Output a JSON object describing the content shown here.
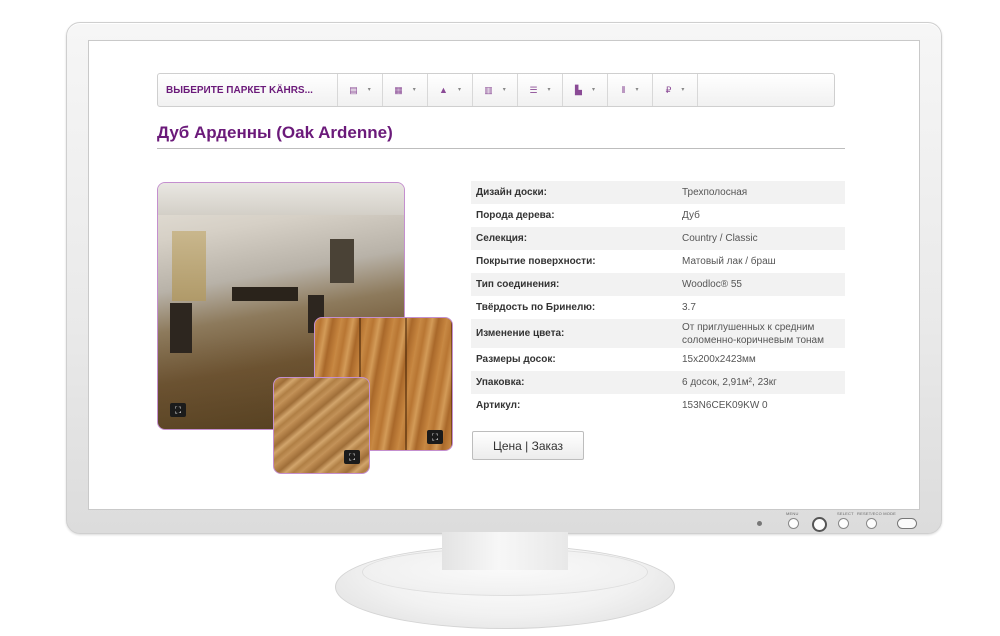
{
  "toolbar": {
    "select_label": "ВЫБЕРИТЕ ПАРКЕТ KÄHRS...",
    "items": [
      {
        "icon": "list-icon",
        "glyph": "▤",
        "caret": "▾"
      },
      {
        "icon": "grid-icon",
        "glyph": "▦",
        "caret": "▾"
      },
      {
        "icon": "tree-icon",
        "glyph": "▲",
        "caret": "▾"
      },
      {
        "icon": "plank-icon",
        "glyph": "▥",
        "caret": "▾"
      },
      {
        "icon": "lines-icon",
        "glyph": "☰",
        "caret": "▾"
      },
      {
        "icon": "layers-icon",
        "glyph": "▙",
        "caret": "▾"
      },
      {
        "icon": "columns-icon",
        "glyph": "⦀",
        "caret": "▾"
      },
      {
        "icon": "ruble-icon",
        "glyph": "₽",
        "caret": "▾"
      }
    ]
  },
  "product": {
    "title": "Дуб Арденны (Oak Ardenne)"
  },
  "specs": [
    {
      "key": "Дизайн доски:",
      "value": "Трехполосная"
    },
    {
      "key": "Порода дерева:",
      "value": "Дуб"
    },
    {
      "key": "Селекция:",
      "value": "Country / Classic"
    },
    {
      "key": "Покрытие поверхности:",
      "value": "Матовый лак / браш"
    },
    {
      "key": "Тип соединения:",
      "value": "Woodloc® 55"
    },
    {
      "key": "Твёрдость по Бринелю:",
      "value": "3.7"
    },
    {
      "key": "Изменение цвета:",
      "value": "От приглушенных к средним соломенно-коричневым тонам"
    },
    {
      "key": "Размеры досок:",
      "value": "15x200x2423мм"
    },
    {
      "key": "Упаковка:",
      "value": "6 досок, 2,91м², 23кг"
    },
    {
      "key": "Артикул:",
      "value": "153N6CEK09KW 0"
    }
  ],
  "order_button": "Цена | Заказ",
  "expand_glyph": "⛶",
  "monitor": {
    "labels": [
      "MENU",
      "SELECT",
      "RESET/ECO MODE"
    ]
  },
  "colors": {
    "accent": "#6b1a7a",
    "frame_border": "#c48fcf"
  }
}
